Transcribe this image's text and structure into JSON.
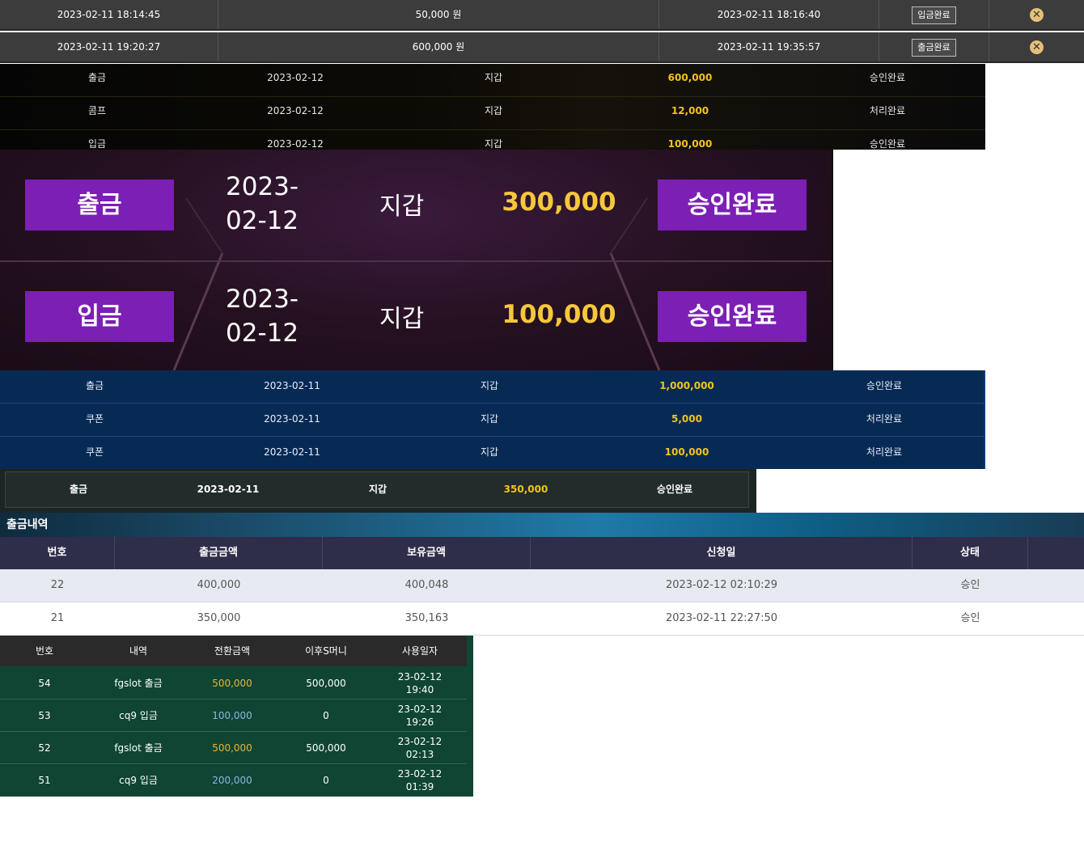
{
  "top_rows": [
    {
      "requested": "2023-02-11 18:14:45",
      "amount": "50,000 원",
      "processed": "2023-02-11 18:16:40",
      "status": "입금완료"
    },
    {
      "requested": "2023-02-11 19:20:27",
      "amount": "600,000 원",
      "processed": "2023-02-11 19:35:57",
      "status": "출금완료"
    }
  ],
  "black_rows": [
    {
      "type": "출금",
      "date": "2023-02-12",
      "wallet": "지갑",
      "amount": "600,000",
      "status": "승인완료"
    },
    {
      "type": "콤프",
      "date": "2023-02-12",
      "wallet": "지갑",
      "amount": "12,000",
      "status": "처리완료"
    },
    {
      "type": "입금",
      "date": "2023-02-12",
      "wallet": "지갑",
      "amount": "100,000",
      "status": "승인완료"
    }
  ],
  "purple_rows": [
    {
      "type": "출금",
      "date_line1": "2023-",
      "date_line2": "02-12",
      "wallet": "지갑",
      "amount": "300,000",
      "status": "승인완료"
    },
    {
      "type": "입금",
      "date_line1": "2023-",
      "date_line2": "02-12",
      "wallet": "지갑",
      "amount": "100,000",
      "status": "승인완료"
    }
  ],
  "blue_rows": [
    {
      "type": "출금",
      "date": "2023-02-11",
      "wallet": "지갑",
      "amount": "1,000,000",
      "status": "승인완료"
    },
    {
      "type": "쿠폰",
      "date": "2023-02-11",
      "wallet": "지갑",
      "amount": "5,000",
      "status": "처리완료"
    },
    {
      "type": "쿠폰",
      "date": "2023-02-11",
      "wallet": "지갑",
      "amount": "100,000",
      "status": "처리완료"
    }
  ],
  "teal_row": {
    "type": "출금",
    "date": "2023-02-11",
    "wallet": "지갑",
    "amount": "350,000",
    "status": "승인완료"
  },
  "withdraw_table": {
    "title": "출금내역",
    "columns": [
      "번호",
      "출금금액",
      "보유금액",
      "신청일",
      "상태"
    ],
    "rows": [
      {
        "no": "22",
        "amount": "400,000",
        "balance": "400,048",
        "date": "2023-02-12 02:10:29",
        "status": "승인"
      },
      {
        "no": "21",
        "amount": "350,000",
        "balance": "350,163",
        "date": "2023-02-11 22:27:50",
        "status": "승인"
      }
    ]
  },
  "money_table": {
    "columns": [
      "번호",
      "내역",
      "전환금액",
      "이후S머니",
      "사용일자"
    ],
    "rows": [
      {
        "no": "54",
        "desc": "fgslot 출금",
        "amount": "500,000",
        "after": "500,000",
        "date1": "23-02-12",
        "date2": "19:40",
        "color": "gold"
      },
      {
        "no": "53",
        "desc": "cq9 입금",
        "amount": "100,000",
        "after": "0",
        "date1": "23-02-12",
        "date2": "19:26",
        "color": "blue"
      },
      {
        "no": "52",
        "desc": "fgslot 출금",
        "amount": "500,000",
        "after": "500,000",
        "date1": "23-02-12",
        "date2": "02:13",
        "color": "gold"
      },
      {
        "no": "51",
        "desc": "cq9 입금",
        "amount": "200,000",
        "after": "0",
        "date1": "23-02-12",
        "date2": "01:39",
        "color": "blue"
      }
    ]
  },
  "colors": {
    "gold": "#f2c31a",
    "purple": "#7b1fb5",
    "blue_bg": "#072a55",
    "green_bg": "#0f4532"
  },
  "icons": {
    "close": "close-icon"
  }
}
